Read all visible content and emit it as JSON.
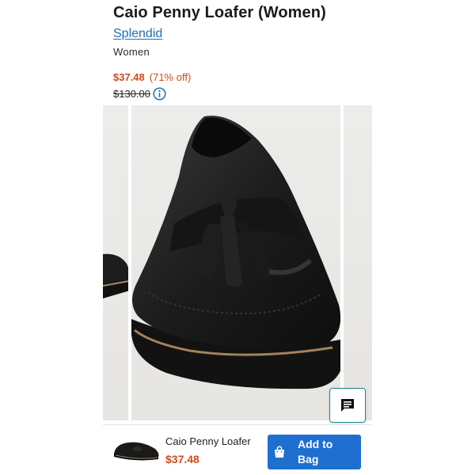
{
  "product": {
    "title": "Caio Penny Loafer (Women)",
    "brand": "Splendid",
    "gender": "Women"
  },
  "pricing": {
    "sale_price": "$37.48",
    "discount": "(71% off)",
    "original_price": "$130.00",
    "info_icon": "info-circle-icon"
  },
  "gallery": {
    "image": "black leather tassel loafer"
  },
  "chat": {
    "icon": "chat-bubble-icon"
  },
  "bottom_bar": {
    "name": "Caio Penny Loafer",
    "price": "$37.48",
    "button_label": "Add to Bag",
    "button_icon": "shopping-bag-icon"
  },
  "colors": {
    "sale": "#d04a1c",
    "link": "#1f6fb2",
    "button": "#1f6fd0",
    "chat_border": "#1e8a8a"
  }
}
